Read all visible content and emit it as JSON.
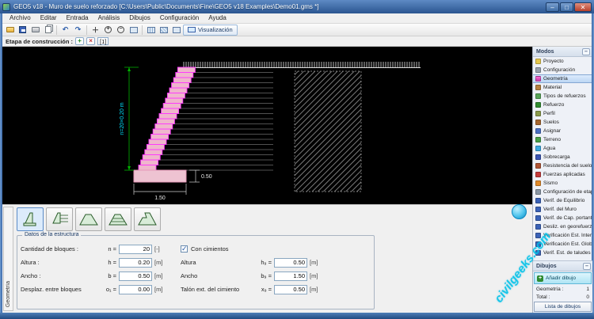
{
  "window": {
    "title": "GEO5 v18 - Muro de suelo reforzado [C:\\Users\\Public\\Documents\\Fine\\GEO5 v18 Examples\\Demo01.gms *]",
    "controls": {
      "minimize": "–",
      "maximize": "□",
      "close": "✕"
    }
  },
  "menu": {
    "items": [
      "Archivo",
      "Editar",
      "Entrada",
      "Análisis",
      "Dibujos",
      "Configuración",
      "Ayuda"
    ]
  },
  "toolbar": {
    "visualization_label": "Visualización"
  },
  "stage_bar": {
    "label": "Etapa de construcción :",
    "stage": "[1]"
  },
  "canvas": {
    "height_dim": "n=20×0.20 m",
    "foundation_width_dim": "1.50",
    "foundation_height_dim": "0.50"
  },
  "modes": {
    "title": "Modos",
    "collapse": "–",
    "items": [
      {
        "label": "Proyecto",
        "icon": "project-icon"
      },
      {
        "label": "Configuración",
        "icon": "settings-icon"
      },
      {
        "label": "Geometría",
        "icon": "geometry-icon",
        "selected": true
      },
      {
        "label": "Material",
        "icon": "material-icon"
      },
      {
        "label": "Tipos de refuerzos",
        "icon": "reinforcement-types-icon"
      },
      {
        "label": "Refuerzo",
        "icon": "reinforcement-icon"
      },
      {
        "label": "Perfil",
        "icon": "profile-icon"
      },
      {
        "label": "Suelos",
        "icon": "soils-icon"
      },
      {
        "label": "Asignar",
        "icon": "assign-icon"
      },
      {
        "label": "Terreno",
        "icon": "terrain-icon"
      },
      {
        "label": "Agua",
        "icon": "water-icon"
      },
      {
        "label": "Sobrecarga",
        "icon": "surcharge-icon"
      },
      {
        "label": "Resistencia del suelo",
        "icon": "soil-resistance-icon"
      },
      {
        "label": "Fuerzas aplicadas",
        "icon": "applied-forces-icon"
      },
      {
        "label": "Sismo",
        "icon": "earthquake-icon"
      },
      {
        "label": "Configuración de etapa",
        "icon": "stage-settings-icon"
      },
      {
        "label": "Verif. de Equilibrio",
        "icon": "verify-icon"
      },
      {
        "label": "Verif. del Muro",
        "icon": "verify-icon"
      },
      {
        "label": "Verif. de Cap. portante",
        "icon": "verify-icon"
      },
      {
        "label": "Desliz. en georefuerzo",
        "icon": "verify-icon"
      },
      {
        "label": "Verificación Est. Interna",
        "icon": "verify-icon"
      },
      {
        "label": "Verificación Est. Global",
        "icon": "verify-icon"
      },
      {
        "label": "Verif. Est. de taludes",
        "icon": "verify-icon"
      }
    ]
  },
  "drawings_panel": {
    "title": "Dibujos",
    "collapse": "–",
    "add_button": "Añadir dibujo",
    "rows": [
      {
        "label": "Geometría :",
        "value": "1"
      },
      {
        "label": "Total :",
        "value": "0"
      }
    ],
    "list_button": "Lista de dibujos"
  },
  "bottom": {
    "group_title": "Datos de la estructura",
    "fields_left": [
      {
        "label": "Cantidad de bloques :",
        "symbol": "n =",
        "value": "20",
        "unit": "[-]"
      },
      {
        "label": "Altura :",
        "symbol": "h =",
        "value": "0.20",
        "unit": "[m]"
      },
      {
        "label": "Ancho :",
        "symbol": "b =",
        "value": "0.50",
        "unit": "[m]"
      },
      {
        "label": "Desplaz. entre bloques",
        "symbol": "o₁ =",
        "value": "0.00",
        "unit": "[m]"
      }
    ],
    "checkbox_label": "Con cimientos",
    "fields_right": [
      {
        "label": "Altura",
        "symbol": "h₉ =",
        "value": "0.50",
        "unit": "[m]"
      },
      {
        "label": "Ancho",
        "symbol": "b₉ =",
        "value": "1.50",
        "unit": "[m]"
      },
      {
        "label": "Talón ext. del cimiento",
        "symbol": "x₉ =",
        "value": "0.50",
        "unit": "[m]"
      }
    ]
  },
  "left_tab": "Geometría",
  "watermark": {
    "text": "civilgeeks.com"
  },
  "colors": {
    "block_stroke": "#ff35ff",
    "block_fill": "#efb6cc",
    "dimension_green": "#00b400",
    "dimension_cyan": "#00e0ff",
    "selection_blue": "#bcd6f4"
  }
}
